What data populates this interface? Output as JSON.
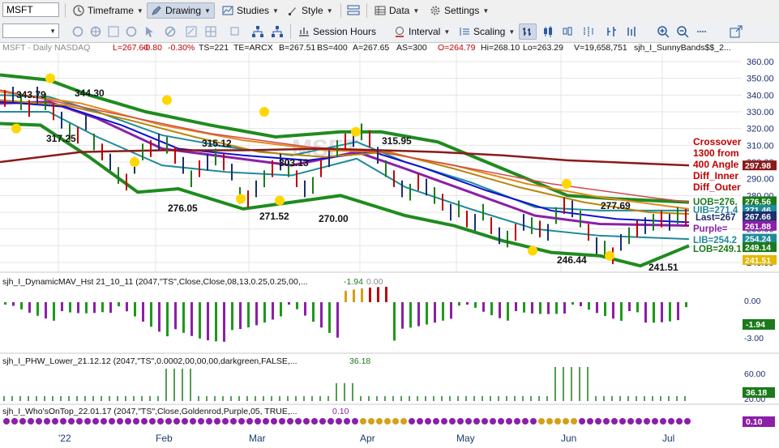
{
  "toolbar1": {
    "symbol": "MSFT",
    "timeframe_label": "Timeframe",
    "drawing_label": "Drawing",
    "studies_label": "Studies",
    "style_label": "Style",
    "data_label": "Data",
    "settings_label": "Settings"
  },
  "toolbar2": {
    "session_hours_label": "Session Hours",
    "interval_label": "Interval",
    "scaling_label": "Scaling"
  },
  "header": {
    "symbol_desc": "MSFT - Daily  NASDAQ",
    "last": "L=267.60",
    "change": "-0.80",
    "change_pct": "-0.30%",
    "ts": "TS=221",
    "te": "TE=ARCX",
    "bid": "B=267.51",
    "bs": "BS=400",
    "ask": "A=267.65",
    "as": "AS=300",
    "open": "O=264.79",
    "high": "Hi=268.10",
    "low": "Lo=263.29",
    "volume": "V=19,658,751",
    "study": "sjh_I_SunnyBands$$_2..."
  },
  "price_axis": {
    "ticks": [
      "360.00",
      "350.00",
      "340.00",
      "330.00",
      "320.00",
      "310.00",
      "300.00",
      "290.00",
      "280.00",
      "270.00",
      "260.00",
      "250.00",
      "240.00"
    ],
    "tags": [
      {
        "label": "297.98",
        "color": "#8b1a1a"
      },
      {
        "label": "276.56",
        "color": "#1c7a1c"
      },
      {
        "label": "271.46",
        "color": "#1f8a9a"
      },
      {
        "label": "267.66",
        "color": "#1d2f6e"
      },
      {
        "label": "261.88",
        "color": "#8b1fa8"
      },
      {
        "label": "254.24",
        "color": "#1f8a9a"
      },
      {
        "label": "249.14",
        "color": "#1c7a1c"
      },
      {
        "label": "241.51",
        "color": "#e6b800"
      }
    ]
  },
  "annotations": {
    "price_labels": [
      "343.79",
      "344.30",
      "317.25",
      "315.12",
      "303.13",
      "276.05",
      "271.52",
      "270.00",
      "315.95",
      "277.69",
      "246.44",
      "241.51"
    ],
    "legend_red": [
      "Crossover",
      "1300 from",
      "400",
      "Angle",
      "Diff_Inner",
      "Diff_Outer"
    ],
    "band_labels": [
      {
        "label": "UOB=276.",
        "color": "#1c7a1c"
      },
      {
        "label": "UIB=271.4",
        "color": "#1f8a9a"
      },
      {
        "label": "Last=267",
        "color": "#1d2f6e"
      },
      {
        "label": "Purple=",
        "color": "#8b1fa8"
      },
      {
        "label": "LIB=254.2",
        "color": "#1f8a9a"
      },
      {
        "label": "LOB=249.1",
        "color": "#1c7a1c"
      }
    ],
    "watermark": "MSFT"
  },
  "panels": {
    "dynamic_mav": {
      "title": "sjh_I_DynamicMAV_Hst 21_10_11 (2047,\"TS\",Close,Close,08,13,0.25,0.25,00,...",
      "v1": "-1.94",
      "v2": "0.00",
      "ticks": [
        "0.00",
        "-3.00"
      ],
      "tag": "-1.94"
    },
    "phw_lower": {
      "title": "sjh_I_PHW_Lower_21.12.12 (2047,\"TS\",0.0002,00,00,00,darkgreen,FALSE,...",
      "v1": "36.18",
      "ticks": [
        "60.00",
        "20.00"
      ],
      "tag": "36.18"
    },
    "whos_on_top": {
      "title": "sjh_I_Who'sOnTop_22.01.17 (2047,\"TS\",Close,Goldenrod,Purple,05, TRUE,...",
      "v1": "0.10",
      "tag": "0.10"
    }
  },
  "x_axis": {
    "labels": [
      "'22",
      "Feb",
      "Mar",
      "Apr",
      "May",
      "Jun",
      "Jul"
    ]
  }
}
